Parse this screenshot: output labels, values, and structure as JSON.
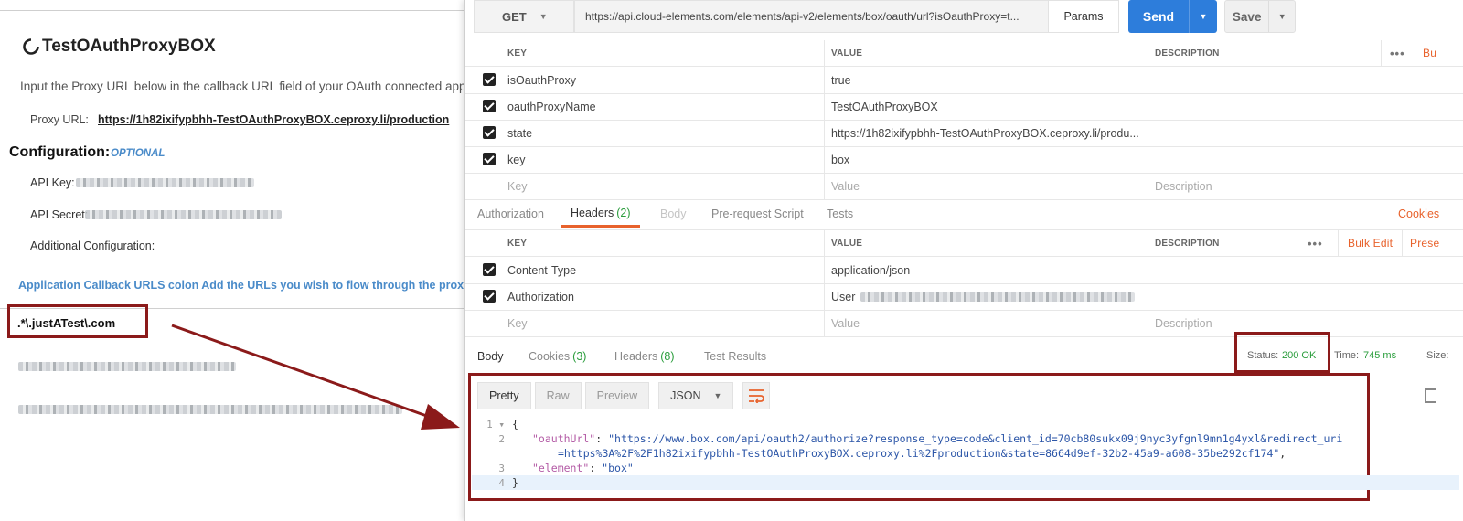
{
  "left": {
    "title": "TestOAuthProxyBOX",
    "intro": "Input the Proxy URL below in the callback URL field of your OAuth connected app",
    "proxy_label": "Proxy URL:",
    "proxy_url": "https://1h82ixifypbhh-TestOAuthProxyBOX.ceproxy.li/production",
    "config_heading": "Configuration:",
    "config_optional": "OPTIONAL",
    "api_key_label": "API Key:",
    "api_secret_label": "API Secret:",
    "additional_label": "Additional Configuration:",
    "callback_note": "Application Callback URLS colon Add the URLs you wish to flow through the prox",
    "callback_regex": ".*\\.justATest\\.com"
  },
  "request": {
    "method": "GET",
    "url": "https://api.cloud-elements.com/elements/api-v2/elements/box/oauth/url?isOauthProxy=t...",
    "params_label": "Params",
    "send_label": "Send",
    "save_label": "Save"
  },
  "params_table": {
    "headers": [
      "KEY",
      "VALUE",
      "DESCRIPTION"
    ],
    "bulk_label": "Bu",
    "rows": [
      {
        "key": "isOauthProxy",
        "value": "true"
      },
      {
        "key": "oauthProxyName",
        "value": "TestOAuthProxyBOX"
      },
      {
        "key": "state",
        "value": "https://1h82ixifypbhh-TestOAuthProxyBOX.ceproxy.li/produ..."
      },
      {
        "key": "key",
        "value": "box"
      }
    ],
    "placeholder": {
      "key": "Key",
      "value": "Value",
      "description": "Description"
    }
  },
  "request_tabs": {
    "authorization": "Authorization",
    "headers": "Headers",
    "headers_count": "(2)",
    "body": "Body",
    "prerequest": "Pre-request Script",
    "tests": "Tests",
    "cookies": "Cookies"
  },
  "headers_table": {
    "headers": [
      "KEY",
      "VALUE",
      "DESCRIPTION"
    ],
    "bulk_edit": "Bulk Edit",
    "presets": "Prese",
    "rows": [
      {
        "key": "Content-Type",
        "value": "application/json"
      },
      {
        "key": "Authorization",
        "value": "User"
      }
    ],
    "placeholder": {
      "key": "Key",
      "value": "Value",
      "description": "Description"
    }
  },
  "response_tabs": {
    "body": "Body",
    "cookies": "Cookies",
    "cookies_count": "(3)",
    "headers": "Headers",
    "headers_count": "(8)",
    "tests": "Test Results"
  },
  "response_meta": {
    "status_label": "Status:",
    "status_value": "200 OK",
    "time_label": "Time:",
    "time_value": "745 ms",
    "size_label": "Size:"
  },
  "response_toolbar": {
    "pretty": "Pretty",
    "raw": "Raw",
    "preview": "Preview",
    "format": "JSON"
  },
  "response_code": {
    "line1": "{",
    "oauth_key": "\"oauthUrl\"",
    "oauth_val_1": "\"https://www.box.com/api/oauth2/authorize?response_type=code&client_id=70cb80sukx09j9nyc3yfgnl9mn1g4yxl&redirect_uri",
    "oauth_val_2": "=https%3A%2F%2F1h82ixifypbhh-TestOAuthProxyBOX.ceproxy.li%2Fproduction&state=8664d9ef-32b2-45a9-a608-35be292cf174\"",
    "element_key": "\"element\"",
    "element_val": "\"box\"",
    "line4": "}",
    "numbers": [
      "1",
      "2",
      "3",
      "4"
    ]
  },
  "colors": {
    "accent": "#e8622c",
    "send_blue": "#2d7ddb",
    "status_green": "#2a9d3c",
    "annotation_red": "#8b1a1a",
    "link_blue": "#4a8bc9"
  }
}
